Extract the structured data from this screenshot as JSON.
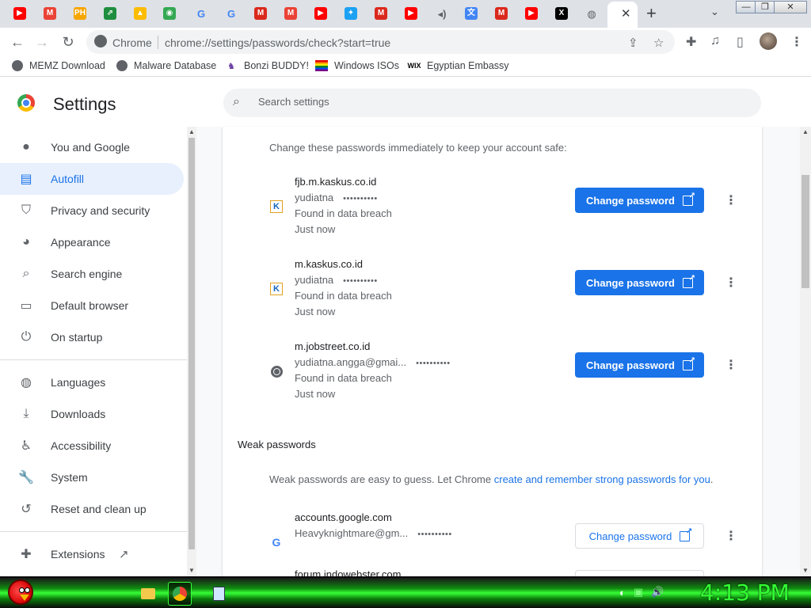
{
  "browser": {
    "tabs": [
      {
        "icon": "youtube-icon",
        "glyph": "▶",
        "color": "#ff0000"
      },
      {
        "icon": "gmail-icon",
        "glyph": "M",
        "color": "#ea4335"
      },
      {
        "icon": "ph-icon",
        "glyph": "PH",
        "color": "#f7a600"
      },
      {
        "icon": "app-icon",
        "glyph": "⇗",
        "color": "#1e8e3e"
      },
      {
        "icon": "drive-icon",
        "glyph": "▲",
        "color": "#fbbc04"
      },
      {
        "icon": "maps-icon",
        "glyph": "◉",
        "color": "#34a853"
      },
      {
        "icon": "google-icon",
        "glyph": "G",
        "color": "#4285f4"
      },
      {
        "icon": "google-icon",
        "glyph": "G",
        "color": "#4285f4"
      },
      {
        "icon": "mcdonalds-icon",
        "glyph": "M",
        "color": "#da291c"
      },
      {
        "icon": "gmail-icon",
        "glyph": "M",
        "color": "#ea4335"
      },
      {
        "icon": "youtube-icon",
        "glyph": "▶",
        "color": "#ff0000"
      },
      {
        "icon": "twitter-icon",
        "glyph": "✦",
        "color": "#1da1f2"
      },
      {
        "icon": "mcdonalds-icon",
        "glyph": "M",
        "color": "#da291c"
      },
      {
        "icon": "youtube-icon",
        "glyph": "▶",
        "color": "#ff0000"
      },
      {
        "icon": "sound-icon",
        "glyph": "◂)",
        "color": "#5f6368"
      },
      {
        "icon": "translate-icon",
        "glyph": "文",
        "color": "#4285f4"
      },
      {
        "icon": "mcdonalds-icon",
        "glyph": "M",
        "color": "#da291c"
      },
      {
        "icon": "youtube-icon",
        "glyph": "▶",
        "color": "#ff0000"
      },
      {
        "icon": "x-icon",
        "glyph": "X",
        "color": "#000000"
      },
      {
        "icon": "globe-icon",
        "glyph": "◍",
        "color": "#5f6368"
      }
    ],
    "active_tab_close": "✕",
    "new_tab": "+",
    "tab_search": "⌄",
    "window_controls": [
      "—",
      "❐",
      "✕"
    ]
  },
  "omnibox": {
    "site_label": "Chrome",
    "url": "chrome://settings/passwords/check?start=true"
  },
  "bookmarks": [
    {
      "label": "MEMZ Download",
      "icon": "globe-icon"
    },
    {
      "label": "Malware Database",
      "icon": "globe-icon"
    },
    {
      "label": "Bonzi BUDDY!",
      "icon": "bonzi-icon"
    },
    {
      "label": "Windows ISOs",
      "icon": "rainbow-flag-icon"
    },
    {
      "label": "Egyptian Embassy",
      "icon": "wix-icon"
    }
  ],
  "settings": {
    "title": "Settings",
    "search_placeholder": "Search settings"
  },
  "sidebar": {
    "items": [
      {
        "label": "You and Google",
        "icon": "person-icon",
        "active": false
      },
      {
        "label": "Autofill",
        "icon": "clipboard-icon",
        "active": true
      },
      {
        "label": "Privacy and security",
        "icon": "shield-icon",
        "active": false
      },
      {
        "label": "Appearance",
        "icon": "palette-icon",
        "active": false
      },
      {
        "label": "Search engine",
        "icon": "search-icon",
        "active": false
      },
      {
        "label": "Default browser",
        "icon": "browser-icon",
        "active": false
      },
      {
        "label": "On startup",
        "icon": "power-icon",
        "active": false
      },
      {
        "label": "Languages",
        "icon": "globe-icon",
        "active": false
      },
      {
        "label": "Downloads",
        "icon": "download-icon",
        "active": false
      },
      {
        "label": "Accessibility",
        "icon": "accessibility-icon",
        "active": false
      },
      {
        "label": "System",
        "icon": "wrench-icon",
        "active": false
      },
      {
        "label": "Reset and clean up",
        "icon": "history-icon",
        "active": false
      },
      {
        "label": "Extensions",
        "icon": "puzzle-icon",
        "active": false
      }
    ]
  },
  "main": {
    "compromised_intro": "Change these passwords immediately to keep your account safe:",
    "compromised": [
      {
        "site": "fjb.m.kaskus.co.id",
        "username": "yudiatna",
        "password_mask": "••••••••••",
        "status": "Found in data breach",
        "time": "Just now",
        "icon": "kaskus-icon",
        "button": "Change password"
      },
      {
        "site": "m.kaskus.co.id",
        "username": "yudiatna",
        "password_mask": "••••••••••",
        "status": "Found in data breach",
        "time": "Just now",
        "icon": "kaskus-icon",
        "button": "Change password"
      },
      {
        "site": "m.jobstreet.co.id",
        "username": "yudiatna.angga@gmai...",
        "password_mask": "••••••••••",
        "status": "Found in data breach",
        "time": "Just now",
        "icon": "globe-icon",
        "button": "Change password"
      }
    ],
    "weak_title": "Weak passwords",
    "weak_desc_prefix": "Weak passwords are easy to guess. Let Chrome ",
    "weak_desc_link": "create and remember strong passwords for you",
    "weak_desc_suffix": ".",
    "weak": [
      {
        "site": "accounts.google.com",
        "username": "Heavyknightmare@gm...",
        "password_mask": "••••••••••",
        "icon": "google-icon",
        "button": "Change password"
      },
      {
        "site": "forum.indowebster.com",
        "username": "",
        "password_mask": "",
        "icon": "globe-icon",
        "button": "Change password"
      }
    ]
  },
  "taskbar": {
    "clock": "4:13 PM",
    "items": [
      "folder-icon",
      "chrome-icon",
      "notepad-icon"
    ]
  },
  "colors": {
    "accent": "#1a73e8",
    "active_nav_bg": "#e8f0fe"
  }
}
